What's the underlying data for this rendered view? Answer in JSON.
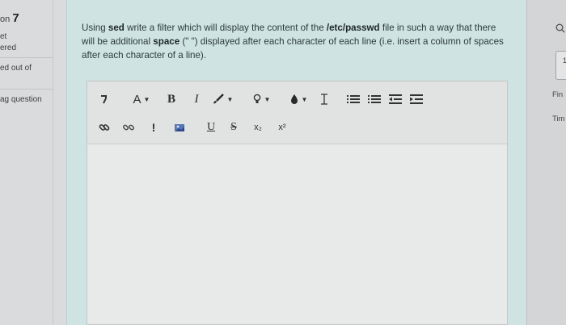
{
  "left_panel": {
    "question_prefix": "on",
    "question_number": "7",
    "status_line1": "et",
    "status_line2": "ered",
    "mark_text": "ed out of",
    "flag_text": "ag question"
  },
  "question": {
    "text_1": "Using ",
    "bold_1": "sed",
    "text_2": " write a filter which will display the content of the ",
    "bold_2": "/etc/passwd",
    "text_3": " file in such a way that there will be additional ",
    "bold_3": "space",
    "text_4": " (\" \") displayed after each character of each line (i.e. insert a column of spaces after each character of a line)."
  },
  "toolbar": {
    "toggle_icon": "toolbar-toggle-icon",
    "font_size_label": "A",
    "bold_label": "B",
    "italic_label": "I",
    "underline_label": "U",
    "strike_label": "S",
    "subscript_label": "x₂",
    "superscript_label": "x²",
    "emoticon_label": "!"
  },
  "editor": {
    "content": ""
  },
  "right_panel": {
    "search_icon": "search-icon",
    "number": "1",
    "finish_text": "Fin",
    "time_text": "Tim"
  }
}
